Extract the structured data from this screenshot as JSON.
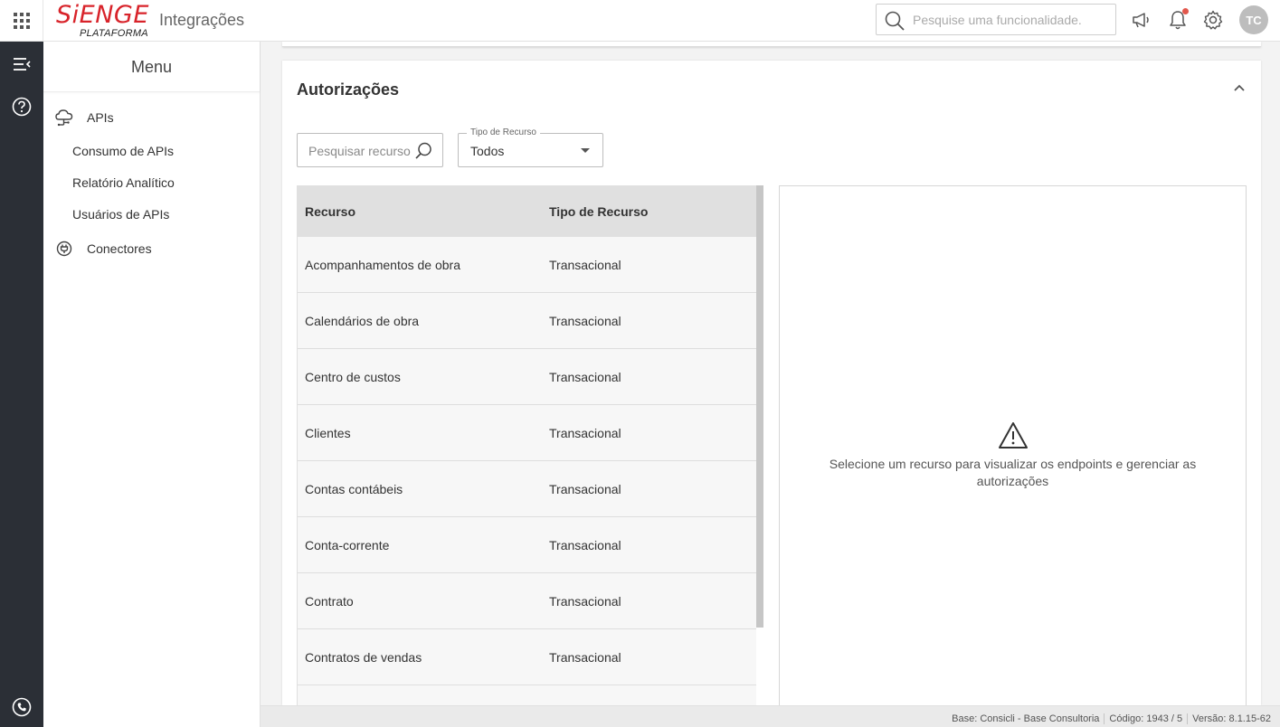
{
  "header": {
    "logo_text": "Sienge",
    "logo_subtitle": "PLATAFORMA",
    "app_title": "Integrações",
    "search_placeholder": "Pesquise uma funcionalidade.",
    "avatar_initials": "TC"
  },
  "sidebar": {
    "title": "Menu",
    "sections": [
      {
        "label": "APIs",
        "icon": "cloud-network-icon",
        "items": [
          "Consumo de APIs",
          "Relatório Analítico",
          "Usuários de APIs"
        ]
      },
      {
        "label": "Conectores",
        "icon": "connector-icon",
        "items": []
      }
    ]
  },
  "main": {
    "card_title": "Autorizações",
    "resource_search_placeholder": "Pesquisar recurso",
    "type_filter": {
      "label": "Tipo de Recurso",
      "value": "Todos"
    },
    "table": {
      "headers": [
        "Recurso",
        "Tipo de Recurso"
      ],
      "rows": [
        [
          "Acompanhamentos de obra",
          "Transacional"
        ],
        [
          "Calendários de obra",
          "Transacional"
        ],
        [
          "Centro de custos",
          "Transacional"
        ],
        [
          "Clientes",
          "Transacional"
        ],
        [
          "Contas contábeis",
          "Transacional"
        ],
        [
          "Conta-corrente",
          "Transacional"
        ],
        [
          "Contrato",
          "Transacional"
        ],
        [
          "Contratos de vendas",
          "Transacional"
        ]
      ]
    },
    "detail_message": "Selecione um recurso para visualizar os endpoints e gerenciar as autorizações"
  },
  "statusbar": {
    "base": "Base: Consicli - Base Consultoria",
    "codigo": "Código: 1943 / 5",
    "versao": "Versão: 8.1.15-62"
  },
  "colors": {
    "brand": "#d8232a",
    "rail": "#2b2f36",
    "notification": "#e2574c"
  }
}
